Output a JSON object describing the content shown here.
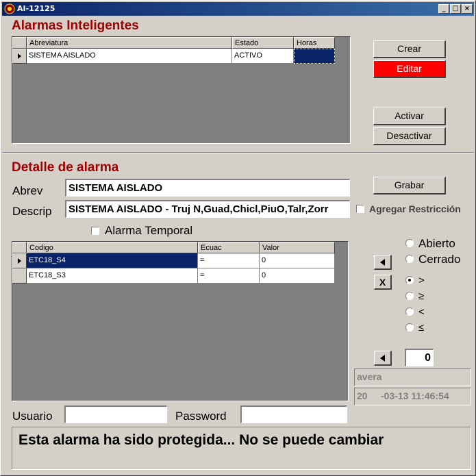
{
  "window": {
    "title": "AI-12125",
    "minimize": "_",
    "maximize": "□",
    "close": "×"
  },
  "alarmas": {
    "title": "Alarmas Inteligentes",
    "columns": [
      "Abreviatura",
      "Estado",
      "Horas"
    ],
    "rows": [
      {
        "abreviatura": "SISTEMA AISLADO",
        "estado": "ACTIVO",
        "horas": ""
      }
    ],
    "buttons": {
      "crear": "Crear",
      "editar": "Editar",
      "activar": "Activar",
      "desactivar": "Desactivar"
    }
  },
  "detalle": {
    "title": "Detalle de alarma",
    "abrev_label": "Abrev",
    "abrev_value": "SISTEMA AISLADO",
    "descrip_label": "Descrip",
    "descrip_value": "SISTEMA AISLADO - Truj N,Guad,Chicl,PiuO,Talr,Zorr",
    "grabar": "Grabar",
    "agregar_restriccion": "Agregar Restricción",
    "alarma_temporal": "Alarma Temporal",
    "columns": [
      "Codigo",
      "Ecuac",
      "Valor"
    ],
    "rows": [
      {
        "codigo": "ETC18_S4",
        "ecuac": "=",
        "valor": "0"
      },
      {
        "codigo": "ETC18_S3",
        "ecuac": "=",
        "valor": "0"
      }
    ],
    "remove_button": "X",
    "estado_options": [
      "Abierto",
      "Cerrado"
    ],
    "operator_options": [
      ">",
      "≥",
      "<",
      "≤"
    ],
    "operator_selected": 0,
    "numeric_value": "0",
    "user_display": "avera",
    "timestamp_display": "20     -03-13 11:46:54",
    "usuario_label": "Usuario",
    "password_label": "Password",
    "usuario_value": "",
    "password_value": "",
    "message": "Esta alarma ha sido protegida... No se puede cambiar"
  },
  "colors": {
    "title_red": "#a00000",
    "edit_red": "#ff0000",
    "selection_navy": "#0a246a"
  }
}
